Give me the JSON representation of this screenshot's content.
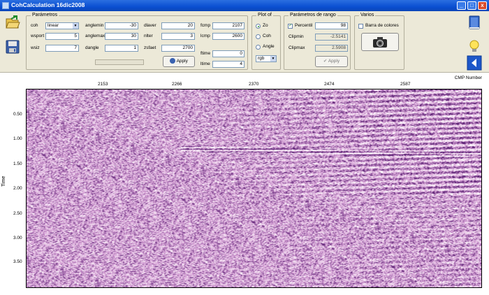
{
  "window": {
    "title": "CohCalculation 16dic2008",
    "min": "_",
    "max": "□",
    "close": "x"
  },
  "parametros": {
    "legend": "Parámetros",
    "ccm_label": "coh",
    "ccm_value": "linear",
    "wsport_label": "wsport",
    "wsport_value": "5",
    "wsiz_label": "wsiz",
    "wsiz_value": "7",
    "anglemin_label": "anglemin",
    "anglemin_value": "-30",
    "anglemax_label": "anglemax",
    "anglemax_value": "30",
    "dangle_label": "dangle",
    "dangle_value": "1",
    "dlaver_label": "dlaver",
    "dlaver_value": "20",
    "nlter_label": "nlter",
    "nlter_value": "3",
    "zsfaet_label": "zsfaet",
    "zsfaet_value": "2700",
    "fcmp_label": "fcmp",
    "fcmp_value": "2107",
    "lcmp_label": "lcmp",
    "lcmp_value": "2600",
    "ftime_label": "ftime",
    "ftime_value": "0",
    "ltime_label": "ltime",
    "ltime_value": "4",
    "apply_label": "Apply"
  },
  "plotof": {
    "legend": "Plot of",
    "options": [
      "Zo",
      "Coh",
      "Angle"
    ],
    "selected": "Zo",
    "colormap": "rgb"
  },
  "rango": {
    "legend": "Parámetros de rango",
    "percentil_label": "Percentil",
    "percentil_value": "98",
    "clipmin_label": "Clipmin",
    "clipmin_value": "-2.5141",
    "clipmax_label": "Clipmax",
    "clipmax_value": "2.5908",
    "apply_label": "Apply"
  },
  "varios": {
    "legend": "Varios",
    "barra_label": "Barra de colores"
  },
  "plot": {
    "xlabel": "CMP Number",
    "ylabel": "Time",
    "xticks": [
      "2153",
      "2266",
      "2370",
      "2474",
      "2587"
    ],
    "yticks": [
      "0.50",
      "1.00",
      "1.50",
      "2.00",
      "2.50",
      "3.00",
      "3.50"
    ],
    "colors": {
      "positive": "#5a1f73",
      "neutral": "#d9a4d8",
      "negative": "#ffffff"
    }
  },
  "chart_data": {
    "type": "heatmap",
    "xlabel": "CMP Number",
    "ylabel": "Time",
    "x_ticks": [
      2153,
      2266,
      2370,
      2474,
      2587
    ],
    "y_ticks": [
      0.5,
      1.0,
      1.5,
      2.0,
      2.5,
      3.0,
      3.5
    ],
    "xlim": [
      2107,
      2600
    ],
    "ylim": [
      0,
      4
    ]
  }
}
